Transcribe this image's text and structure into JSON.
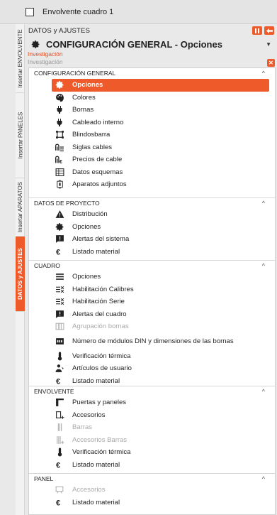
{
  "window": {
    "title": "Envolvente cuadro 1"
  },
  "vertical_tabs": [
    {
      "label": "Insertar ENVOLVENTE",
      "active": false
    },
    {
      "label": "Insertar PANELES",
      "active": false
    },
    {
      "label": "Insertar APARATOS",
      "active": false
    },
    {
      "label": "DATOS y AJUSTES",
      "active": true
    }
  ],
  "panel": {
    "header": "DATOS y AJUSTES",
    "title": "CONFIGURACIÓN GENERAL - Opciones",
    "subtitle_active": "Investigación",
    "subtitle_muted": "Investigación",
    "accent": "#ee5a2a"
  },
  "sections": [
    {
      "title": "CONFIGURACIÓN GENERAL",
      "items": [
        {
          "label": "Opciones",
          "icon": "gear-icon",
          "selected": true
        },
        {
          "label": "Colores",
          "icon": "palette-icon"
        },
        {
          "label": "Bornas",
          "icon": "plug-icon"
        },
        {
          "label": "Cableado interno",
          "icon": "plug-icon"
        },
        {
          "label": "Blindosbarra",
          "icon": "busbar-icon"
        },
        {
          "label": "Siglas cables",
          "icon": "cable-labels-icon"
        },
        {
          "label": "Precios de cable",
          "icon": "cable-price-icon"
        },
        {
          "label": "Datos esquemas",
          "icon": "grid-icon"
        },
        {
          "label": "Aparatos adjuntos",
          "icon": "device-icon"
        }
      ]
    },
    {
      "title": "DATOS DE PROYECTO",
      "items": [
        {
          "label": "Distribución",
          "icon": "warning-triangle-icon"
        },
        {
          "label": "Opciones",
          "icon": "gear-icon"
        },
        {
          "label": "Alertas del sistema",
          "icon": "alert-icon"
        },
        {
          "label": "Listado material",
          "icon": "euro-icon"
        }
      ]
    },
    {
      "title": "CUADRO",
      "items": [
        {
          "label": "Opciones",
          "icon": "list-icon"
        },
        {
          "label": "Habilitación Calibres",
          "icon": "enable-list-icon"
        },
        {
          "label": "Habilitación Serie",
          "icon": "enable-list-icon"
        },
        {
          "label": "Alertas del cuadro",
          "icon": "alert-icon"
        },
        {
          "label": "Agrupación bornas",
          "icon": "terminal-group-icon",
          "disabled": true
        },
        {
          "label": "Número de módulos DIN y dimensiones de las bornas",
          "icon": "din-module-icon"
        },
        {
          "label": "Verificación térmica",
          "icon": "thermometer-icon"
        },
        {
          "label": "Artículos de usuario",
          "icon": "user-items-icon"
        },
        {
          "label": "Listado material",
          "icon": "euro-icon"
        }
      ]
    },
    {
      "title": "ENVOLVENTE",
      "items": [
        {
          "label": "Puertas y paneles",
          "icon": "door-icon"
        },
        {
          "label": "Accesorios",
          "icon": "accessory-add-icon"
        },
        {
          "label": "Barras",
          "icon": "bars-icon",
          "disabled": true
        },
        {
          "label": "Accesorios Barras",
          "icon": "bars-add-icon",
          "disabled": true
        },
        {
          "label": "Verificación térmica",
          "icon": "thermometer-icon"
        },
        {
          "label": "Listado material",
          "icon": "euro-icon"
        }
      ]
    },
    {
      "title": "PANEL",
      "items": [
        {
          "label": "Accesorios",
          "icon": "panel-accessory-icon",
          "disabled": true
        },
        {
          "label": "Listado material",
          "icon": "euro-icon"
        }
      ]
    }
  ]
}
